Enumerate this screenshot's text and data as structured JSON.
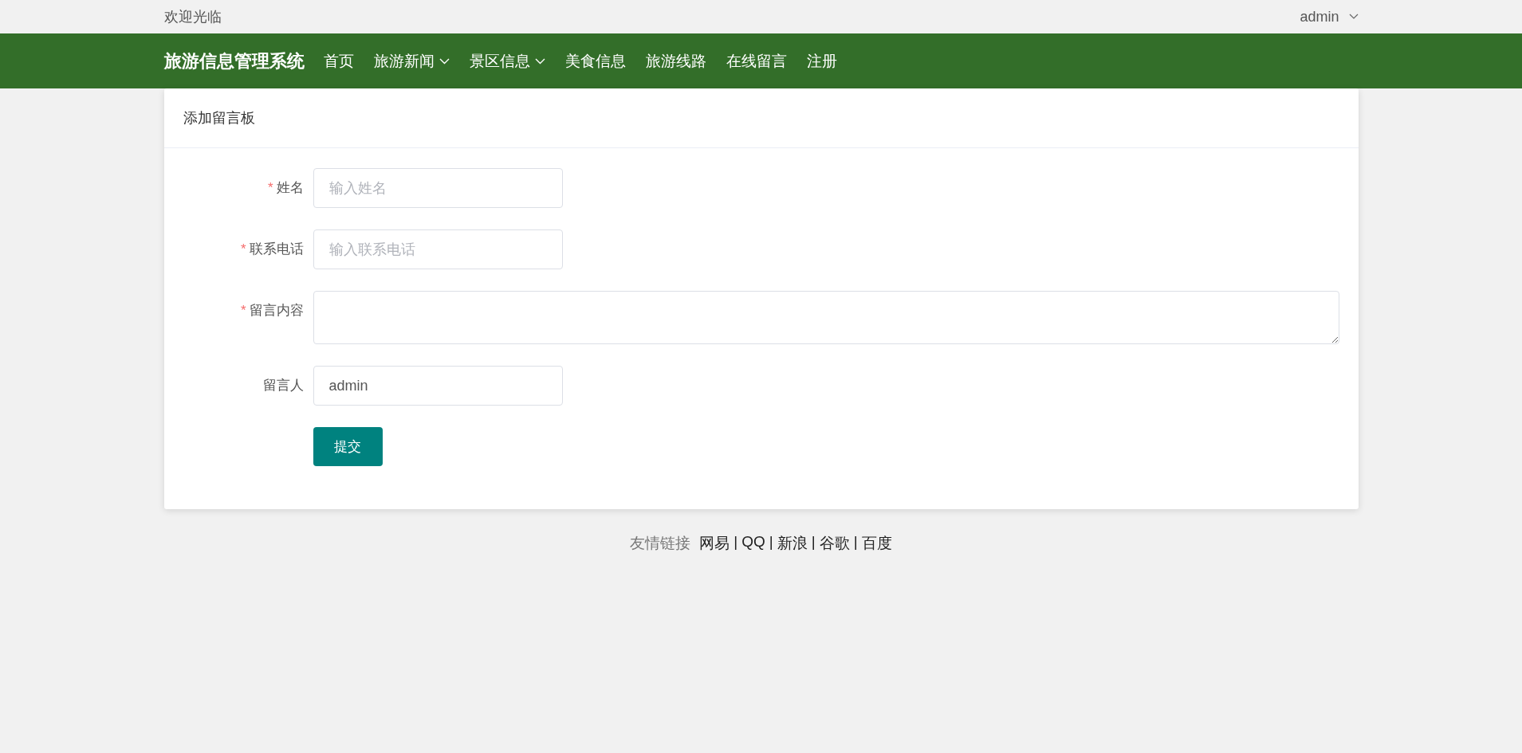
{
  "top_bar": {
    "welcome": "欢迎光临",
    "user": "admin"
  },
  "nav": {
    "brand": "旅游信息管理系统",
    "items": [
      {
        "label": "首页",
        "dropdown": false
      },
      {
        "label": "旅游新闻",
        "dropdown": true
      },
      {
        "label": "景区信息",
        "dropdown": true
      },
      {
        "label": "美食信息",
        "dropdown": false
      },
      {
        "label": "旅游线路",
        "dropdown": false
      },
      {
        "label": "在线留言",
        "dropdown": false
      },
      {
        "label": "注册",
        "dropdown": false
      }
    ]
  },
  "form": {
    "title": "添加留言板",
    "fields": [
      {
        "label": "姓名",
        "required_mark": "*",
        "kind": "input",
        "placeholder": "输入姓名"
      },
      {
        "label": "联系电话",
        "required_mark": "*",
        "kind": "input",
        "placeholder": "输入联系电话"
      },
      {
        "label": "留言内容",
        "required_mark": "*",
        "kind": "textarea"
      },
      {
        "label": "留言人",
        "kind": "input",
        "value": "admin"
      }
    ],
    "submit": "提交"
  },
  "footer": {
    "label": "友情链接",
    "separator": "|",
    "links": [
      "网易",
      "QQ",
      "新浪",
      "谷歌",
      "百度"
    ]
  }
}
